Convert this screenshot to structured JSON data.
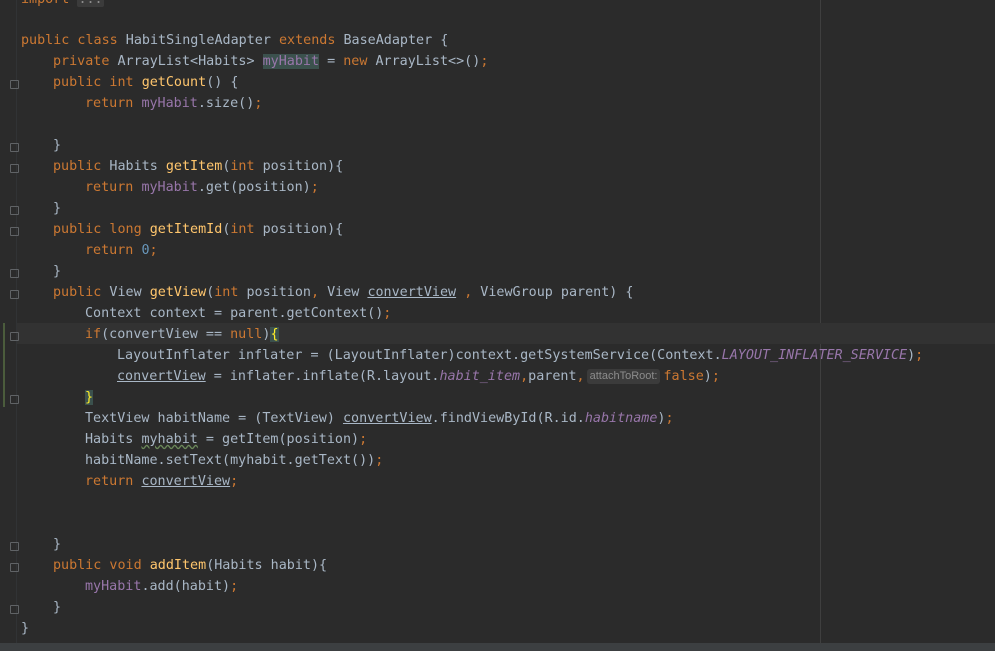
{
  "editor": {
    "hint_label": "attachToRoot:",
    "lines": {
      "l0": [
        "import",
        " ",
        "..."
      ],
      "l1": [
        "public class",
        " HabitSingleAdapter ",
        "extends",
        " BaseAdapter {"
      ],
      "l2": [
        "private",
        " ArrayList<Habits> ",
        "myHabit",
        " = ",
        "new",
        " ArrayList<>()",
        ";"
      ],
      "l3": [
        "public int",
        " ",
        "getCount",
        "() {"
      ],
      "l4": [
        "return",
        " ",
        "myHabit",
        ".size()",
        ";"
      ],
      "l6": [
        "}"
      ],
      "l7": [
        "public",
        " Habits ",
        "getItem",
        "(",
        "int",
        " position){"
      ],
      "l8": [
        "return",
        " ",
        "myHabit",
        ".get(position)",
        ";"
      ],
      "l9": [
        "}"
      ],
      "l10": [
        "public long",
        " ",
        "getItemId",
        "(",
        "int",
        " position){"
      ],
      "l11": [
        "return",
        " ",
        "0",
        ";"
      ],
      "l12": [
        "}"
      ],
      "l13": [
        "public",
        " View ",
        "getView",
        "(",
        "int",
        " position",
        ",",
        " View ",
        "convertView",
        " ",
        ",",
        " ViewGroup parent) {"
      ],
      "l14": [
        "Context context = parent.getContext()",
        ";"
      ],
      "l15": [
        "if",
        "(convertView == ",
        "null",
        ")",
        "{"
      ],
      "l16": [
        "LayoutInflater inflater = (LayoutInflater)context.getSystemService(Context.",
        "LAYOUT_INFLATER_SERVICE",
        ")",
        ";"
      ],
      "l17": [
        "convertView",
        " = inflater.inflate(R.layout.",
        "habit_item",
        ",",
        "parent",
        ",",
        "false",
        ")",
        ";"
      ],
      "l18": [
        "}"
      ],
      "l19": [
        "TextView habitName = (TextView) ",
        "convertView",
        ".findViewById(R.id.",
        "habitname",
        ")",
        ";"
      ],
      "l20": [
        "Habits ",
        "myhabit",
        " = getItem(position)",
        ";"
      ],
      "l21": [
        "habitName.setText(myhabit.getText())",
        ";"
      ],
      "l22": [
        "return",
        " ",
        "convertView",
        ";"
      ],
      "l25": [
        "}"
      ],
      "l26": [
        "public void",
        " ",
        "addItem",
        "(Habits habit){"
      ],
      "l27": [
        "myHabit",
        ".add(habit)",
        ";"
      ],
      "l28": [
        "}"
      ],
      "l29": [
        "}"
      ]
    }
  },
  "colors": {
    "background": "#2b2b2b",
    "keyword": "#cc7832",
    "method": "#ffc66d",
    "field": "#9876aa",
    "number": "#6897bb",
    "text": "#a9b7c6",
    "brace_match": "#ffef28"
  }
}
